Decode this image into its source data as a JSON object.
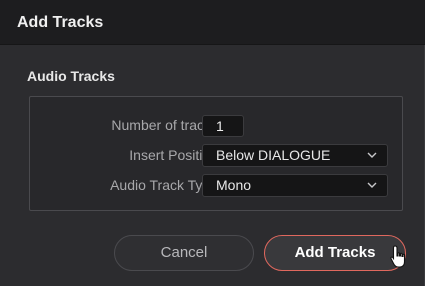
{
  "dialog": {
    "title": "Add Tracks",
    "section_title": "Audio Tracks",
    "fields": {
      "number_of_tracks": {
        "label": "Number of tracks",
        "value": "1"
      },
      "insert_position": {
        "label": "Insert Position",
        "value": "Below DIALOGUE"
      },
      "audio_track_type": {
        "label": "Audio Track Type",
        "value": "Mono"
      }
    },
    "buttons": {
      "cancel": "Cancel",
      "add": "Add Tracks"
    }
  },
  "colors": {
    "accent_border": "#e0685e",
    "background": "#2c2c2f",
    "titlebar": "#1d1d1f"
  },
  "icons": {
    "dropdown": "chevron-down-icon",
    "pointer": "cursor-pointer-icon"
  }
}
